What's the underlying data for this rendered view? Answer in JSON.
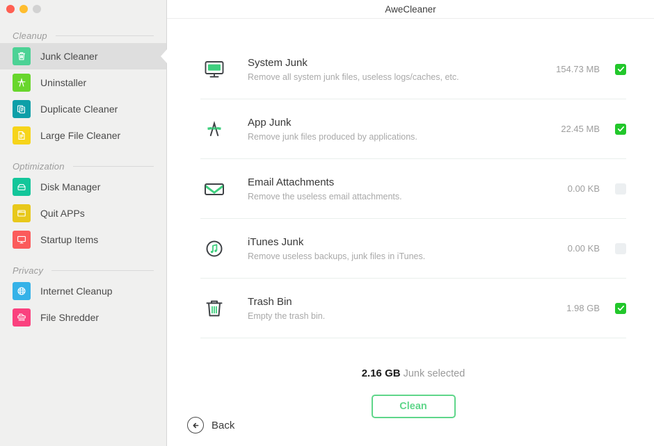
{
  "window": {
    "title": "AweCleaner",
    "traffic_lights": [
      {
        "name": "close",
        "color": "#ff5f52"
      },
      {
        "name": "minimize",
        "color": "#ffbd2e"
      },
      {
        "name": "zoom",
        "color": "#d2d2d2"
      }
    ]
  },
  "sidebar": {
    "sections": [
      {
        "label": "Cleanup",
        "items": [
          {
            "label": "Junk Cleaner",
            "icon": "trash-icon",
            "color": "#4cd295",
            "active": true
          },
          {
            "label": "Uninstaller",
            "icon": "app-store-icon",
            "color": "#68d62c",
            "active": false
          },
          {
            "label": "Duplicate Cleaner",
            "icon": "documents-icon",
            "color": "#0d9fa8",
            "active": false
          },
          {
            "label": "Large File Cleaner",
            "icon": "file-icon",
            "color": "#f6d41a",
            "active": false
          }
        ]
      },
      {
        "label": "Optimization",
        "items": [
          {
            "label": "Disk Manager",
            "icon": "disk-icon",
            "color": "#13c69a",
            "active": false
          },
          {
            "label": "Quit APPs",
            "icon": "window-icon",
            "color": "#e8c81b",
            "active": false
          },
          {
            "label": "Startup Items",
            "icon": "monitor-icon",
            "color": "#fb5b5b",
            "active": false
          }
        ]
      },
      {
        "label": "Privacy",
        "items": [
          {
            "label": "Internet Cleanup",
            "icon": "globe-icon",
            "color": "#35b2e8",
            "active": false
          },
          {
            "label": "File Shredder",
            "icon": "shredder-icon",
            "color": "#fa417e",
            "active": false
          }
        ]
      }
    ]
  },
  "main": {
    "rows": [
      {
        "icon": "monitor-screen-icon",
        "title": "System Junk",
        "description": "Remove all system junk files, useless logs/caches, etc.",
        "size": "154.73 MB",
        "checked": true
      },
      {
        "icon": "app-store-brushes-icon",
        "title": "App Junk",
        "description": "Remove junk files produced by applications.",
        "size": "22.45 MB",
        "checked": true
      },
      {
        "icon": "envelope-icon",
        "title": "Email Attachments",
        "description": "Remove the useless email attachments.",
        "size": "0.00 KB",
        "checked": false
      },
      {
        "icon": "music-note-circle-icon",
        "title": "iTunes Junk",
        "description": "Remove useless backups, junk files in iTunes.",
        "size": "0.00 KB",
        "checked": false
      },
      {
        "icon": "trash-bin-icon",
        "title": "Trash Bin",
        "description": "Empty the trash bin.",
        "size": "1.98 GB",
        "checked": true
      }
    ],
    "summary": {
      "amount": "2.16 GB",
      "text": " Junk selected"
    },
    "clean_label": "Clean",
    "back_label": "Back"
  },
  "colors": {
    "accent_green": "#5fd68a",
    "check_green": "#22c72b",
    "icon_green": "#3ecf7e",
    "sidebar_bg": "#f0f0ef",
    "active_row": "#dedede"
  }
}
